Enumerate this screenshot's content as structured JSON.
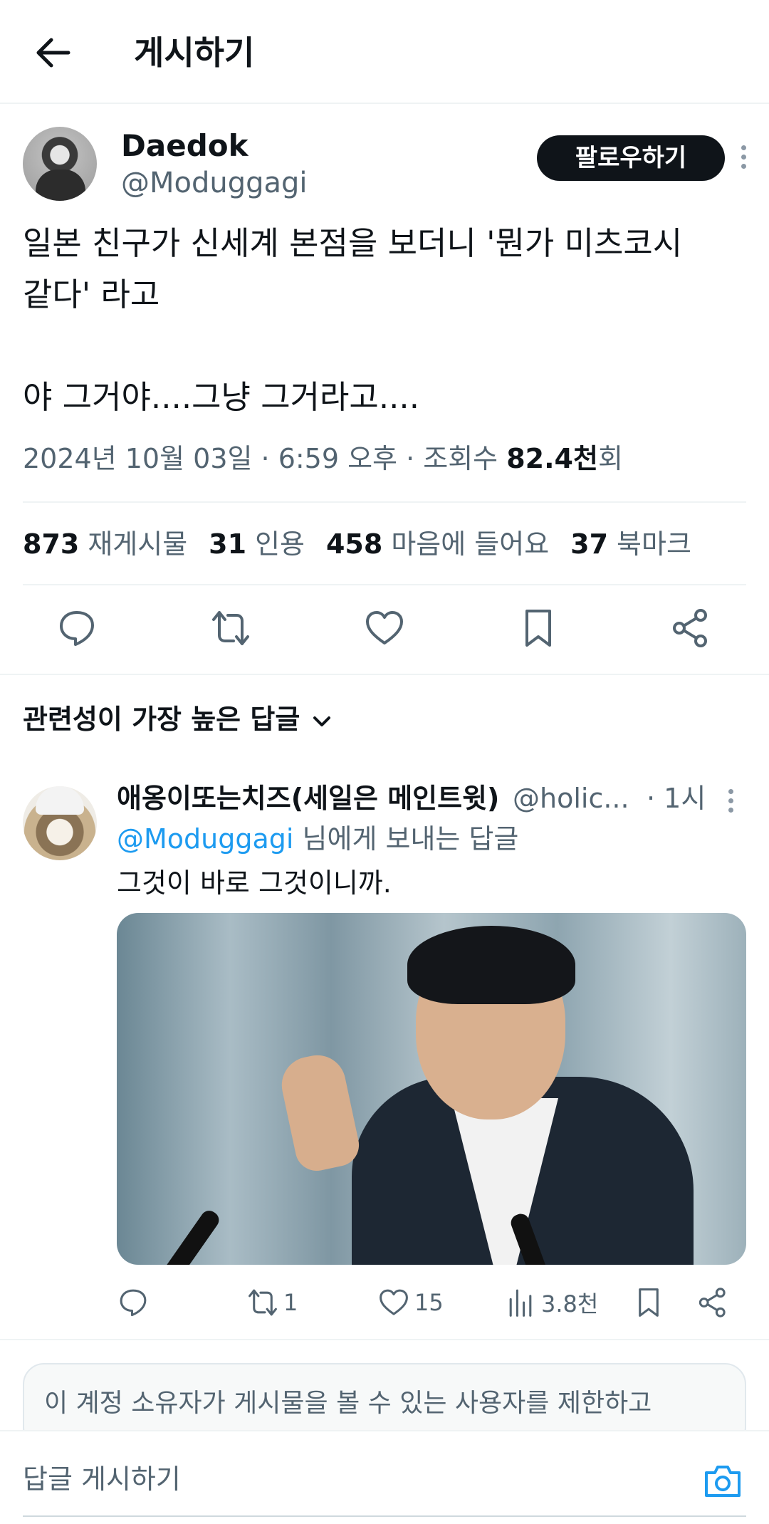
{
  "header": {
    "title": "게시하기",
    "back_icon": "back-arrow-icon"
  },
  "post": {
    "author_name": "Daedok",
    "author_handle": "@Moduggagi",
    "follow_label": "팔로우하기",
    "text": "일본 친구가 신세계 본점을 보더니 '뭔가 미츠코시\n같다' 라고\n\n야 그거야....그냥 그거라고....",
    "timestamp": "2024년 10월 03일 · 6:59 오후 · 조회수 ",
    "views": "82.4천",
    "views_suffix": "회",
    "stats": {
      "reposts": "873",
      "reposts_label": "재게시물",
      "quotes": "31",
      "quotes_label": "인용",
      "likes": "458",
      "likes_label": "마음에 들어요",
      "bookmarks": "37",
      "bookmarks_label": "북마크"
    }
  },
  "replies_section": {
    "sort_label": "관련성이 가장 높은 답글"
  },
  "reply": {
    "name": "애옹이또는치즈(세일은 메인트윗)",
    "handle": "@holic...",
    "time": "· 1시",
    "replying_to_mention": "@Moduggagi",
    "replying_to_suffix": " 님에게 보내는 답글",
    "text": "그것이 바로 그것이니까.",
    "reposts": "1",
    "likes": "15",
    "views": "3.8천"
  },
  "notice": {
    "text": "이 계정 소유자가 게시물을 볼 수 있는 사용자를 제한하고"
  },
  "composer": {
    "placeholder": "답글 게시하기"
  },
  "colors": {
    "accent": "#1d9bf0",
    "text": "#0f1419",
    "muted": "#536471"
  }
}
